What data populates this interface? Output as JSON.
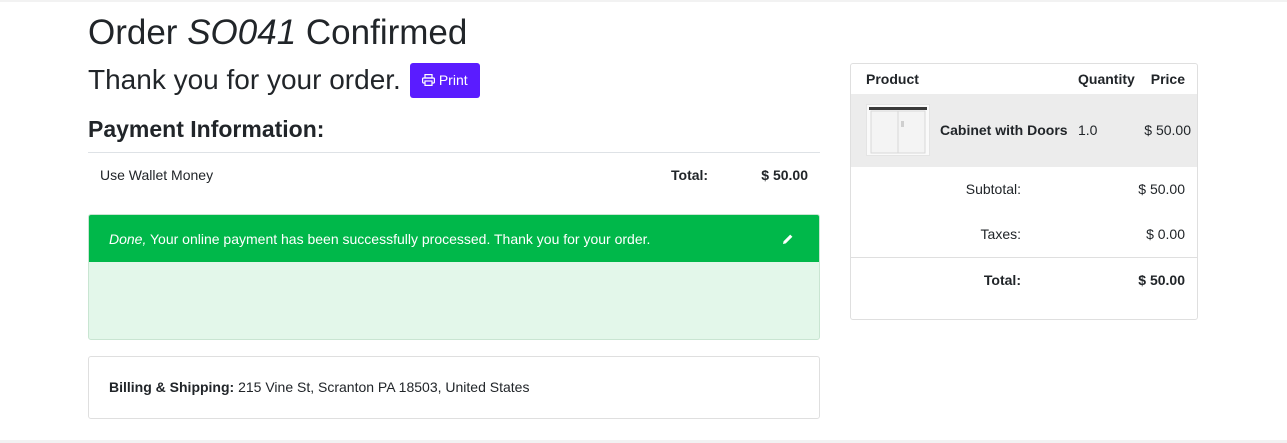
{
  "header": {
    "title_prefix": "Order",
    "order_ref": "SO041",
    "title_suffix": "Confirmed",
    "thank_you": "Thank you for your order.",
    "print_label": "Print",
    "print_icon": "printer-icon"
  },
  "payment": {
    "heading": "Payment Information:",
    "method": "Use Wallet Money",
    "total_label": "Total:",
    "total_value": "$ 50.00"
  },
  "alert": {
    "status_word": "Done,",
    "message": " Your online payment has been successfully processed. Thank you for your order.",
    "edit_icon": "pencil-icon",
    "header_color": "#00b84a",
    "body_color": "#e3f7ea"
  },
  "billing": {
    "label": "Billing & Shipping:",
    "address": " 215 Vine St, Scranton PA 18503, United States"
  },
  "summary": {
    "columns": {
      "product": "Product",
      "quantity": "Quantity",
      "price": "Price"
    },
    "items": [
      {
        "name": "Cabinet with Doors",
        "quantity": "1.0",
        "price": "$ 50.00"
      }
    ],
    "subtotal_label": "Subtotal:",
    "subtotal_value": "$ 50.00",
    "taxes_label": "Taxes:",
    "taxes_value": "$ 0.00",
    "total_label": "Total:",
    "total_value": "$ 50.00"
  },
  "colors": {
    "accent": "#5a1cff",
    "success": "#00b84a"
  }
}
